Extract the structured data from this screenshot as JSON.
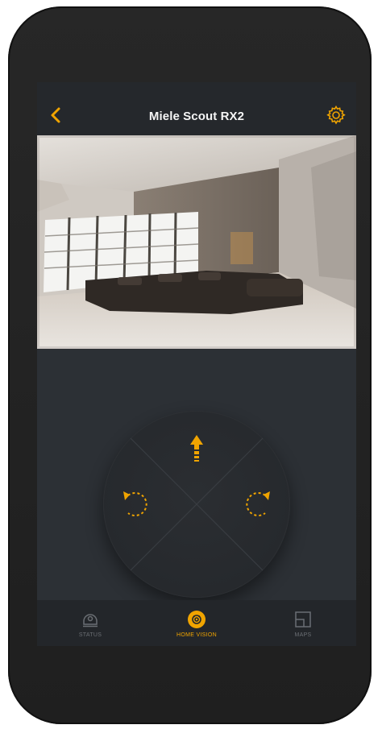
{
  "header": {
    "title": "Miele Scout RX2",
    "back_icon": "chevron-left-icon",
    "settings_icon": "gear-icon"
  },
  "camera": {
    "description_icon": "camera-feed"
  },
  "controls": {
    "forward_icon": "arrow-up-icon",
    "rotate_left_icon": "rotate-left-icon",
    "rotate_right_icon": "rotate-right-icon"
  },
  "tabs": [
    {
      "label": "STATUS",
      "icon": "robot-icon",
      "active": false
    },
    {
      "label": "HOME VISION",
      "icon": "camera-icon",
      "active": true
    },
    {
      "label": "MAPS",
      "icon": "map-icon",
      "active": false
    }
  ],
  "colors": {
    "accent": "#f0a400",
    "background": "#2c3035",
    "header": "#25282c",
    "tab_inactive": "#6b6f74"
  }
}
